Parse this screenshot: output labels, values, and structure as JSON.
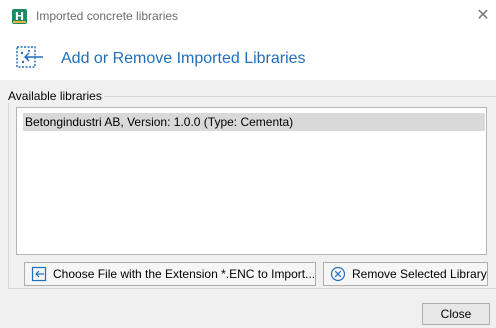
{
  "window": {
    "title": "Imported concrete libraries",
    "app_icon_letter": "H"
  },
  "header": {
    "icon": "import-libraries-icon",
    "title": "Add or Remove Imported Libraries"
  },
  "available": {
    "legend": "Available libraries",
    "items": [
      {
        "label": "Betongindustri AB, Version: 1.0.0 (Type: Cementa)",
        "selected": true
      }
    ]
  },
  "buttons": {
    "choose_file": {
      "label": "Choose File with the Extension *.ENC to Import...",
      "icon": "import-file-icon"
    },
    "remove": {
      "label": "Remove Selected Library",
      "icon": "remove-circle-icon"
    },
    "close": {
      "label": "Close"
    }
  },
  "colors": {
    "accent": "#1f6fbd",
    "app_icon": "#1d8a66",
    "selection": "#d9d9d9"
  }
}
